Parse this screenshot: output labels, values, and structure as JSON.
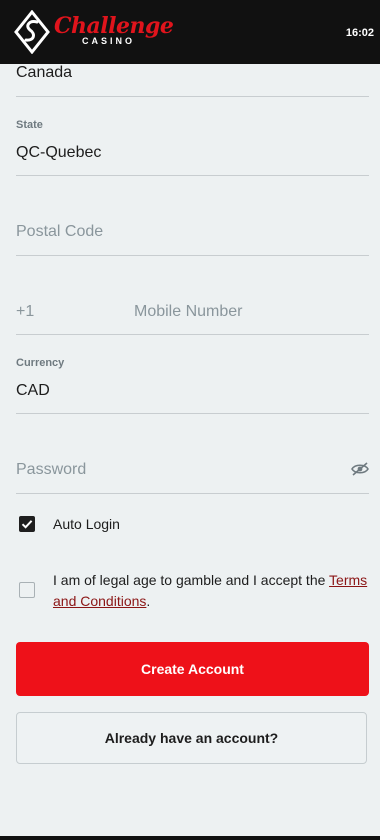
{
  "header": {
    "logo_text": "Challenge",
    "logo_sub": "CASINO",
    "time": "16:02",
    "brand_color": "#e0141c"
  },
  "form": {
    "country": {
      "value": "Canada"
    },
    "state": {
      "label": "State",
      "value": "QC-Quebec"
    },
    "postal_code": {
      "placeholder": "Postal Code"
    },
    "mobile": {
      "prefix": "+1",
      "placeholder": "Mobile Number"
    },
    "currency": {
      "label": "Currency",
      "value": "CAD"
    },
    "password": {
      "placeholder": "Password",
      "icon": "eye-off-icon"
    },
    "auto_login": {
      "label": "Auto Login",
      "checked": true
    },
    "terms": {
      "text_before": "I am of legal age to gamble and I accept the ",
      "link_text_1": "Terms",
      "link_text_2": "and Conditions",
      "text_after": ".",
      "checked": false
    }
  },
  "buttons": {
    "create_account": "Create Account",
    "login": "Already have an account?"
  },
  "colors": {
    "primary_button": "#ee1119",
    "background": "#edf1f2",
    "link": "#8b1515"
  }
}
